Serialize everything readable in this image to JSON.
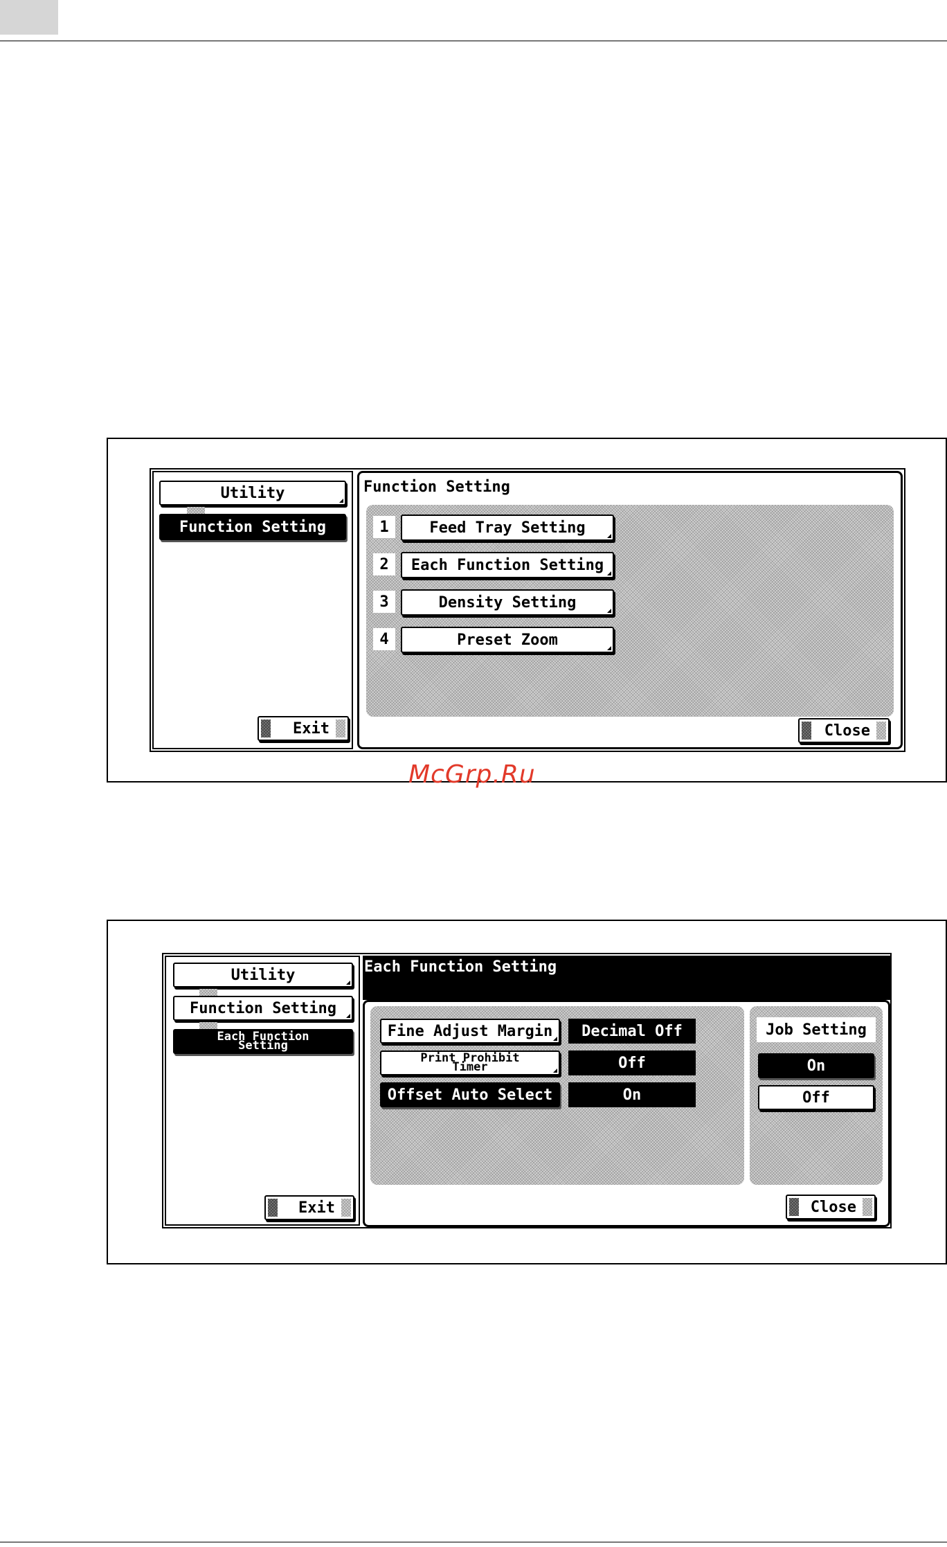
{
  "watermark": "McGrp.Ru",
  "screen1": {
    "breadcrumbs": [
      "Utility",
      "Function Setting"
    ],
    "title": "Function Setting",
    "items": [
      {
        "num": "1",
        "label": "Feed Tray Setting"
      },
      {
        "num": "2",
        "label": "Each Function Setting"
      },
      {
        "num": "3",
        "label": "Density Setting"
      },
      {
        "num": "4",
        "label": "Preset Zoom"
      }
    ],
    "exit_label": "Exit",
    "close_label": "Close"
  },
  "screen2": {
    "breadcrumbs": [
      "Utility",
      "Function Setting"
    ],
    "active_crumb": "Each Function Setting",
    "title": "Each Function Setting",
    "rows": [
      {
        "label": "Fine Adjust Margin",
        "value": "Decimal Off"
      },
      {
        "label": "Print Prohibit Timer",
        "value": "Off"
      },
      {
        "label": "Offset Auto Select",
        "value": "On"
      }
    ],
    "job_setting_label": "Job Setting",
    "on_label": "On",
    "off_label": "Off",
    "exit_label": "Exit",
    "close_label": "Close"
  }
}
